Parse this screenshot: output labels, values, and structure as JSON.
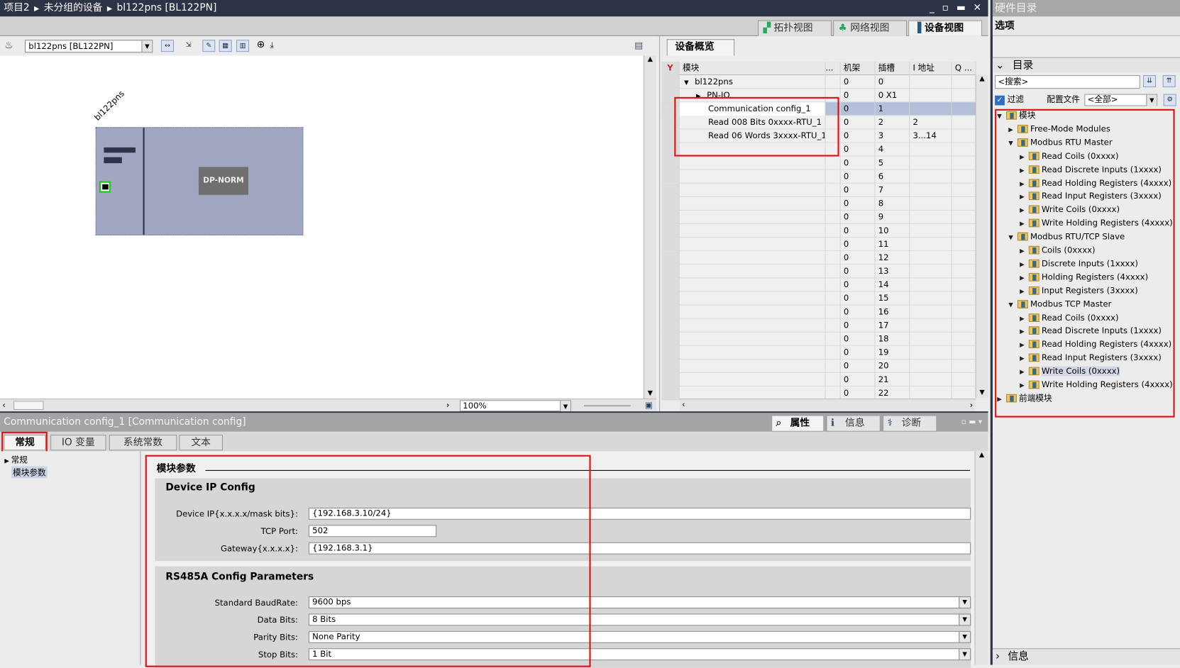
{
  "breadcrumb": [
    "项目2",
    "未分组的设备",
    "bl122pns [BL122PN]"
  ],
  "window_buttons": "_ ▫ ▬ ✕",
  "view_tabs": [
    {
      "label": "拓扑视图",
      "icon": "topology-icon"
    },
    {
      "label": "网络视图",
      "icon": "network-icon"
    },
    {
      "label": "设备视图",
      "icon": "device-icon",
      "active": true
    }
  ],
  "toolbar": {
    "device_select": "bl122pns [BL122PN]"
  },
  "device": {
    "name": "bl122pns",
    "module_label": "DP-NORM"
  },
  "zoom": {
    "value": "100%"
  },
  "overview": {
    "tab": "设备概览",
    "columns": [
      "模块",
      "...",
      "机架",
      "插槽",
      "I 地址",
      "Q ..."
    ],
    "rows": [
      {
        "module": "bl122pns",
        "rack": "0",
        "slot": "0",
        "i": "",
        "level": 0,
        "expand": "▼"
      },
      {
        "module": "PN-IO",
        "rack": "0",
        "slot": "0 X1",
        "i": "",
        "level": 1,
        "expand": "▶"
      },
      {
        "module": "Communication config_1",
        "rack": "0",
        "slot": "1",
        "i": "",
        "level": 1,
        "selected": true
      },
      {
        "module": "Read 008 Bits 0xxxx-RTU_1",
        "rack": "0",
        "slot": "2",
        "i": "2",
        "level": 1
      },
      {
        "module": "Read 06 Words 3xxxx-RTU_1",
        "rack": "0",
        "slot": "3",
        "i": "3...14",
        "level": 1
      },
      {
        "module": "",
        "rack": "0",
        "slot": "4",
        "i": ""
      },
      {
        "module": "",
        "rack": "0",
        "slot": "5",
        "i": ""
      },
      {
        "module": "",
        "rack": "0",
        "slot": "6",
        "i": ""
      },
      {
        "module": "",
        "rack": "0",
        "slot": "7",
        "i": ""
      },
      {
        "module": "",
        "rack": "0",
        "slot": "8",
        "i": ""
      },
      {
        "module": "",
        "rack": "0",
        "slot": "9",
        "i": ""
      },
      {
        "module": "",
        "rack": "0",
        "slot": "10",
        "i": ""
      },
      {
        "module": "",
        "rack": "0",
        "slot": "11",
        "i": ""
      },
      {
        "module": "",
        "rack": "0",
        "slot": "12",
        "i": ""
      },
      {
        "module": "",
        "rack": "0",
        "slot": "13",
        "i": ""
      },
      {
        "module": "",
        "rack": "0",
        "slot": "14",
        "i": ""
      },
      {
        "module": "",
        "rack": "0",
        "slot": "15",
        "i": ""
      },
      {
        "module": "",
        "rack": "0",
        "slot": "16",
        "i": ""
      },
      {
        "module": "",
        "rack": "0",
        "slot": "17",
        "i": ""
      },
      {
        "module": "",
        "rack": "0",
        "slot": "18",
        "i": ""
      },
      {
        "module": "",
        "rack": "0",
        "slot": "19",
        "i": ""
      },
      {
        "module": "",
        "rack": "0",
        "slot": "20",
        "i": ""
      },
      {
        "module": "",
        "rack": "0",
        "slot": "21",
        "i": ""
      },
      {
        "module": "",
        "rack": "0",
        "slot": "22",
        "i": ""
      }
    ]
  },
  "properties": {
    "title": "Communication config_1 [Communication config]",
    "right_tabs": [
      "属性",
      "信息",
      "诊断"
    ],
    "tabs": [
      "常规",
      "IO 变量",
      "系统常数",
      "文本"
    ],
    "nav": [
      "常规",
      "模块参数"
    ],
    "section_title": "模块参数",
    "group1": {
      "title": "Device IP Config",
      "fields": [
        {
          "label": "Device IP{x.x.x.x/mask bits}:",
          "value": "{192.168.3.10/24}"
        },
        {
          "label": "TCP Port:",
          "value": "502"
        },
        {
          "label": "Gateway{x.x.x.x}:",
          "value": "{192.168.3.1}"
        }
      ]
    },
    "group2": {
      "title": "RS485A Config Parameters",
      "fields": [
        {
          "label": "Standard BaudRate:",
          "value": "9600 bps"
        },
        {
          "label": "Data Bits:",
          "value": "8 Bits"
        },
        {
          "label": "Parity Bits:",
          "value": "None Parity"
        },
        {
          "label": "Stop Bits:",
          "value": "1 Bit"
        }
      ]
    }
  },
  "catalog": {
    "title": "硬件目录",
    "options": "选项",
    "section": "目录",
    "search_placeholder": "<搜索>",
    "filter_label": "过滤",
    "profile_label": "配置文件",
    "profile_value": "<全部>",
    "info": "信息",
    "tree": [
      {
        "label": "模块",
        "level": 0,
        "expand": "▼"
      },
      {
        "label": "Free-Mode Modules",
        "level": 1,
        "expand": "▶"
      },
      {
        "label": "Modbus RTU Master",
        "level": 1,
        "expand": "▼"
      },
      {
        "label": "Read Coils (0xxxx)",
        "level": 2,
        "expand": "▶"
      },
      {
        "label": "Read Discrete Inputs (1xxxx)",
        "level": 2,
        "expand": "▶"
      },
      {
        "label": "Read Holding Registers (4xxxx)",
        "level": 2,
        "expand": "▶"
      },
      {
        "label": "Read Input Registers (3xxxx)",
        "level": 2,
        "expand": "▶"
      },
      {
        "label": "Write Coils (0xxxx)",
        "level": 2,
        "expand": "▶"
      },
      {
        "label": "Write Holding Registers (4xxxx)",
        "level": 2,
        "expand": "▶"
      },
      {
        "label": "Modbus RTU/TCP Slave",
        "level": 1,
        "expand": "▼"
      },
      {
        "label": "Coils (0xxxx)",
        "level": 2,
        "expand": "▶"
      },
      {
        "label": "Discrete Inputs (1xxxx)",
        "level": 2,
        "expand": "▶"
      },
      {
        "label": "Holding Registers (4xxxx)",
        "level": 2,
        "expand": "▶"
      },
      {
        "label": "Input Registers (3xxxx)",
        "level": 2,
        "expand": "▶"
      },
      {
        "label": "Modbus TCP Master",
        "level": 1,
        "expand": "▼"
      },
      {
        "label": "Read Coils (0xxxx)",
        "level": 2,
        "expand": "▶"
      },
      {
        "label": "Read Discrete Inputs (1xxxx)",
        "level": 2,
        "expand": "▶"
      },
      {
        "label": "Read Holding Registers (4xxxx)",
        "level": 2,
        "expand": "▶"
      },
      {
        "label": "Read Input Registers (3xxxx)",
        "level": 2,
        "expand": "▶"
      },
      {
        "label": "Write Coils (0xxxx)",
        "level": 2,
        "expand": "▶",
        "selected": true
      },
      {
        "label": "Write Holding Registers (4xxxx)",
        "level": 2,
        "expand": "▶"
      },
      {
        "label": "前端模块",
        "level": 0,
        "expand": "▶"
      }
    ]
  },
  "colors": {
    "titlebar": "#2d3346",
    "highlight_box": "#e01010",
    "selection": "#b4bfd9",
    "rack": "#a1a7c0"
  }
}
